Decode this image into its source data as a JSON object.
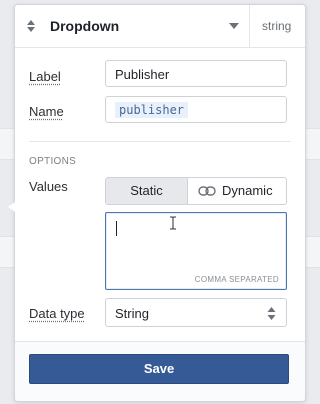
{
  "header": {
    "title": "Dropdown",
    "type_tag": "string"
  },
  "fields": {
    "label": {
      "label": "Label",
      "value": "Publisher"
    },
    "name": {
      "label": "Name",
      "value": "publisher"
    }
  },
  "options": {
    "section_title": "OPTIONS",
    "values_label": "Values",
    "segments": {
      "static": "Static",
      "dynamic": "Dynamic",
      "selected": "Static"
    },
    "textarea": {
      "value": "",
      "hint": "COMMA SEPARATED"
    },
    "data_type": {
      "label": "Data type",
      "value": "String"
    }
  },
  "footer": {
    "save_label": "Save"
  },
  "colors": {
    "primary": "#355a96",
    "focus_border": "#4a78b5",
    "code_pill_bg": "#e7f0fb"
  }
}
